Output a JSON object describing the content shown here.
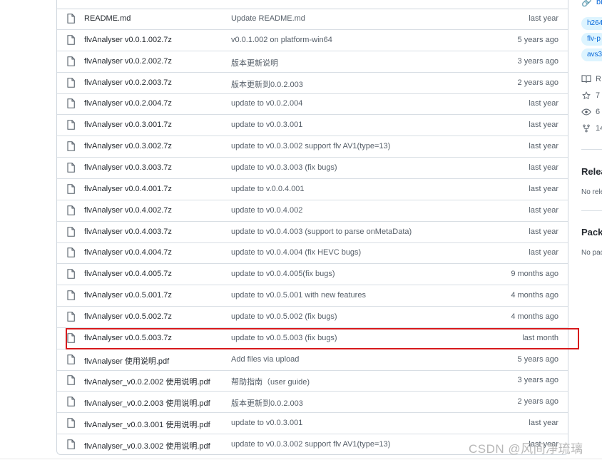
{
  "files": [
    {
      "name": "README.md",
      "message": "Update README.md",
      "age": "last year"
    },
    {
      "name": "flvAnalyser v0.0.1.002.7z",
      "message": "v0.0.1.002 on platform-win64",
      "age": "5 years ago"
    },
    {
      "name": "flvAnalyser v0.0.2.002.7z",
      "message": "版本更新说明",
      "age": "3 years ago"
    },
    {
      "name": "flvAnalyser v0.0.2.003.7z",
      "message": "版本更新到0.0.2.003",
      "age": "2 years ago"
    },
    {
      "name": "flvAnalyser v0.0.2.004.7z",
      "message": "update to v0.0.2.004",
      "age": "last year"
    },
    {
      "name": "flvAnalyser v0.0.3.001.7z",
      "message": "update to v0.0.3.001",
      "age": "last year"
    },
    {
      "name": "flvAnalyser v0.0.3.002.7z",
      "message": "update to v0.0.3.002 support flv AV1(type=13)",
      "age": "last year"
    },
    {
      "name": "flvAnalyser v0.0.3.003.7z",
      "message": "update to v0.0.3.003 (fix bugs)",
      "age": "last year"
    },
    {
      "name": "flvAnalyser v0.0.4.001.7z",
      "message": "update to v.0.0.4.001",
      "age": "last year"
    },
    {
      "name": "flvAnalyser v0.0.4.002.7z",
      "message": "update to v0.0.4.002",
      "age": "last year"
    },
    {
      "name": "flvAnalyser v0.0.4.003.7z",
      "message": "update to v0.0.4.003 (support to parse onMetaData)",
      "age": "last year"
    },
    {
      "name": "flvAnalyser v0.0.4.004.7z",
      "message": "update to v0.0.4.004 (fix HEVC bugs)",
      "age": "last year"
    },
    {
      "name": "flvAnalyser v0.0.4.005.7z",
      "message": "update to v0.0.4.005(fix bugs)",
      "age": "9 months ago"
    },
    {
      "name": "flvAnalyser v0.0.5.001.7z",
      "message": "update to v0.0.5.001 with new features",
      "age": "4 months ago"
    },
    {
      "name": "flvAnalyser v0.0.5.002.7z",
      "message": "update to v0.0.5.002 (fix bugs)",
      "age": "4 months ago"
    },
    {
      "name": "flvAnalyser v0.0.5.003.7z",
      "message": "update to v0.0.5.003 (fix bugs)",
      "age": "last month"
    },
    {
      "name": "flvAnalyser 使用说明.pdf",
      "message": "Add files via upload",
      "age": "5 years ago"
    },
    {
      "name": "flvAnalyser_v0.0.2.002 使用说明.pdf",
      "message": "帮助指南（user guide)",
      "age": "3 years ago"
    },
    {
      "name": "flvAnalyser_v0.0.2.003 使用说明.pdf",
      "message": "版本更新到0.0.2.003",
      "age": "2 years ago"
    },
    {
      "name": "flvAnalyser_v0.0.3.001 使用说明.pdf",
      "message": "update to v0.0.3.001",
      "age": "last year"
    },
    {
      "name": "flvAnalyser_v0.0.3.002 使用说明.pdf",
      "message": "update to v0.0.3.002 support flv AV1(type=13)",
      "age": "last year"
    }
  ],
  "sidebar": {
    "link_text": "bl",
    "topics": [
      "h264",
      "flv-p",
      "avs3"
    ],
    "stats": [
      {
        "icon": "book-icon",
        "text": "R"
      },
      {
        "icon": "star-icon",
        "text": "7"
      },
      {
        "icon": "eye-icon",
        "text": "6"
      },
      {
        "icon": "fork-icon",
        "text": "14"
      }
    ],
    "releases_heading": "Relea",
    "releases_sub": "No rele",
    "packages_heading": "Packa",
    "packages_sub": "No pac"
  },
  "watermark": "CSDN @风间净琉璃",
  "colors": {
    "highlight": "#d7191c",
    "link": "#0969da",
    "topic_bg": "#ddf4ff"
  }
}
